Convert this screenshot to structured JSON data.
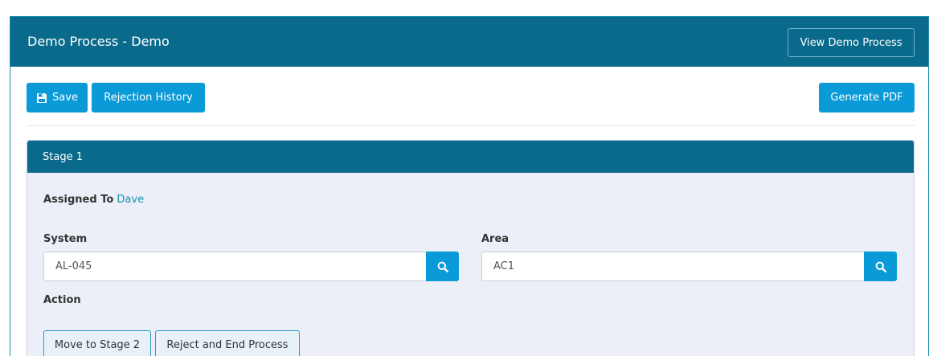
{
  "header": {
    "title": "Demo Process - Demo",
    "view_button_label": "View Demo Process"
  },
  "toolbar": {
    "save_label": "Save",
    "save_icon": "floppy-disk-icon",
    "rejection_history_label": "Rejection History",
    "generate_pdf_label": "Generate PDF"
  },
  "stage": {
    "title": "Stage 1",
    "assigned_to_label": "Assigned To",
    "assigned_to_name": "Dave",
    "system": {
      "label": "System",
      "value": "AL-045",
      "search_icon": "search-icon"
    },
    "area": {
      "label": "Area",
      "value": "AC1",
      "search_icon": "search-icon"
    },
    "action": {
      "label": "Action",
      "move_label": "Move to Stage 2",
      "reject_label": "Reject and End Process"
    }
  },
  "colors": {
    "header_bg": "#0a6a8c",
    "button_blue": "#0a9ad7",
    "panel_bg": "#eceff7",
    "link": "#1a8fb0"
  }
}
